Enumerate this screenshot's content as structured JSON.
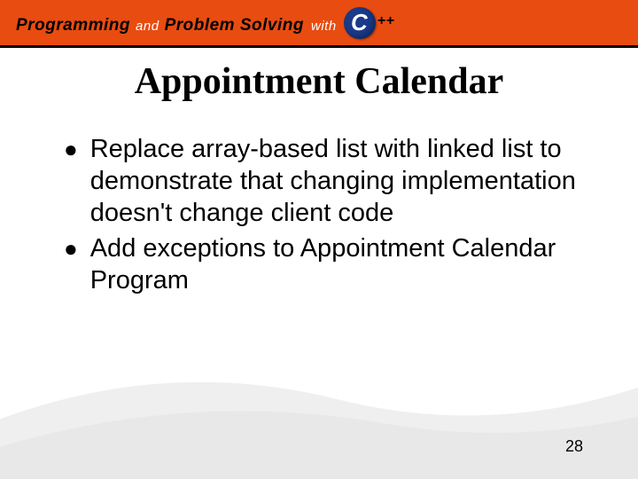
{
  "header": {
    "word1": "Programming",
    "and": "and",
    "word2": "Problem Solving",
    "with": "with",
    "cpp_c": "C",
    "cpp_plus": "++"
  },
  "title": "Appointment Calendar",
  "bullets": [
    "Replace array-based list with linked list to demonstrate that changing implementation doesn't change client code",
    "Add exceptions to Appointment Calendar Program"
  ],
  "page_number": "28"
}
